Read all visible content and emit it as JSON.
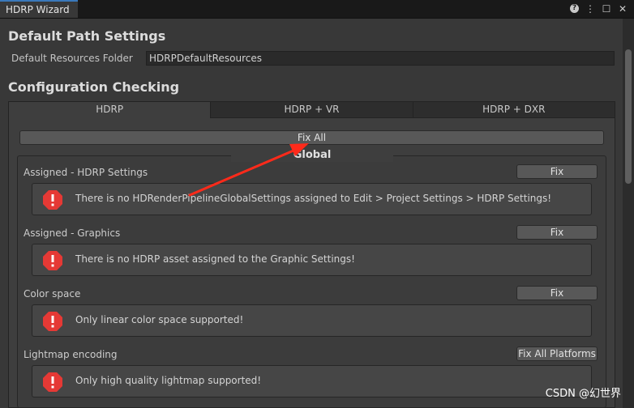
{
  "window": {
    "tab_title": "HDRP Wizard"
  },
  "sections": {
    "default_path": {
      "title": "Default Path Settings",
      "resources_label": "Default Resources Folder",
      "resources_value": "HDRPDefaultResources"
    },
    "config": {
      "title": "Configuration Checking"
    }
  },
  "tabs": [
    {
      "label": "HDRP",
      "active": true
    },
    {
      "label": "HDRP + VR",
      "active": false
    },
    {
      "label": "HDRP + DXR",
      "active": false
    }
  ],
  "fix_all_label": "Fix All",
  "group_title": "Global",
  "checks": [
    {
      "label": "Assigned - HDRP Settings",
      "button": "Fix",
      "message": "There is no HDRenderPipelineGlobalSettings assigned to Edit > Project Settings > HDRP Settings!"
    },
    {
      "label": "Assigned - Graphics",
      "button": "Fix",
      "message": "There is no HDRP asset assigned to the Graphic Settings!"
    },
    {
      "label": "Color space",
      "button": "Fix",
      "message": "Only linear color space supported!"
    },
    {
      "label": "Lightmap encoding",
      "button": "Fix All Platforms",
      "message": "Only high quality lightmap supported!"
    }
  ],
  "watermark": "CSDN @幻世界",
  "icons": {
    "help": "help-icon",
    "menu": "more-options-icon",
    "maximize": "maximize-icon",
    "close": "close-icon",
    "error": "error-stop-icon"
  },
  "colors": {
    "error": "#e53935",
    "arrow": "#ff2a1a",
    "tab_accent": "#3a79bb"
  }
}
